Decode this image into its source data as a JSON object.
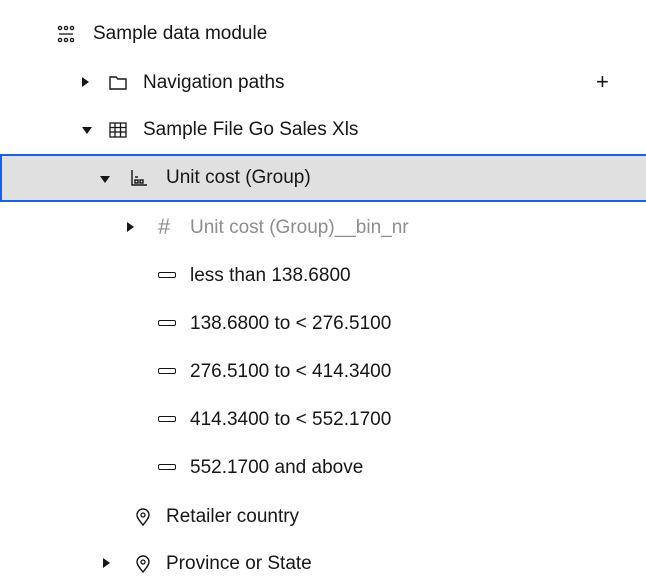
{
  "tree": {
    "root": {
      "label": "Sample data module",
      "icon": "data-module-icon"
    },
    "navigation_paths": {
      "label": "Navigation paths",
      "add_label": "+"
    },
    "table": {
      "label": "Sample File Go Sales Xls",
      "icon": "table-icon"
    },
    "group": {
      "label": "Unit cost (Group)",
      "icon": "group-icon"
    },
    "bin_field": {
      "label": "Unit cost (Group)__bin_nr",
      "icon": "hash-icon"
    },
    "bins": [
      {
        "label": "less than 138.6800"
      },
      {
        "label": "138.6800 to < 276.5100"
      },
      {
        "label": "276.5100 to < 414.3400"
      },
      {
        "label": "414.3400 to < 552.1700"
      },
      {
        "label": "552.1700 and above"
      }
    ],
    "retailer_country": {
      "label": "Retailer country",
      "icon": "location-icon"
    },
    "province_or_state": {
      "label": "Province or State",
      "icon": "location-icon"
    }
  },
  "colors": {
    "selection_border": "#0f62fe",
    "selection_bg": "#e0e0e0"
  }
}
